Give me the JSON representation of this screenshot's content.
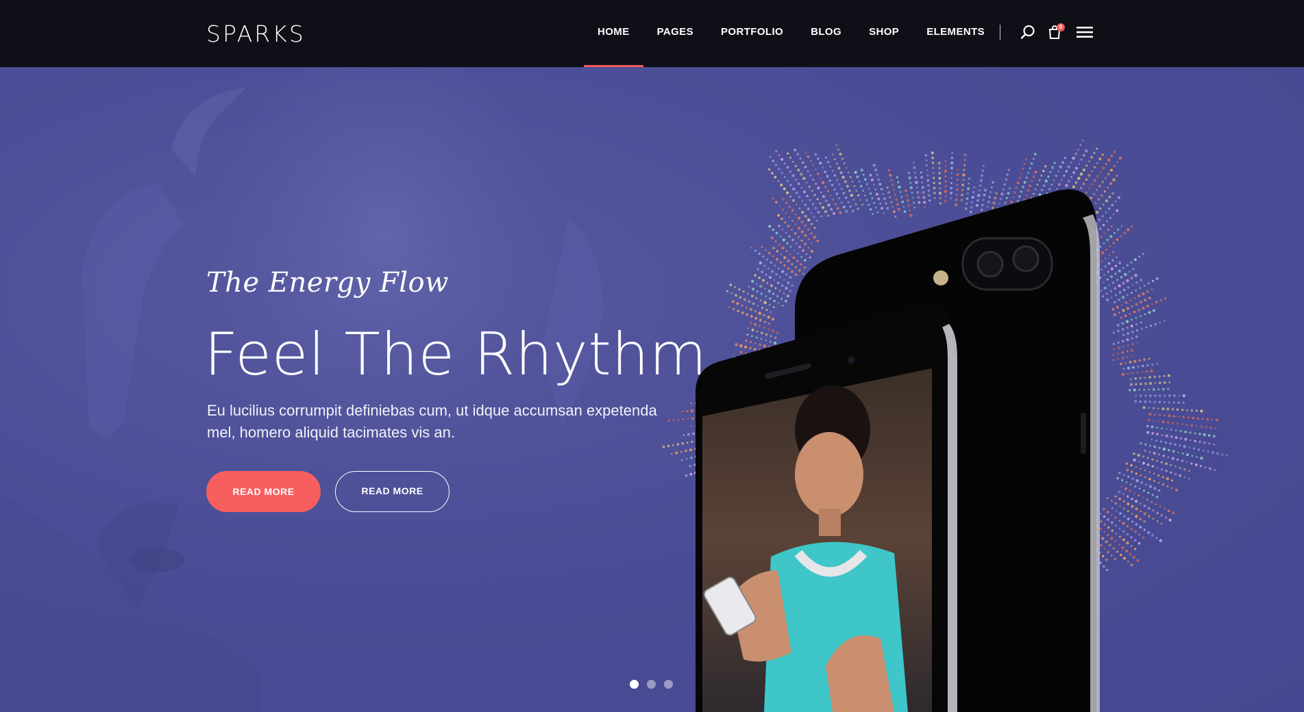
{
  "header": {
    "logo": "SPARKS",
    "nav": [
      {
        "label": "HOME",
        "active": true
      },
      {
        "label": "PAGES",
        "active": false
      },
      {
        "label": "PORTFOLIO",
        "active": false
      },
      {
        "label": "BLOG",
        "active": false
      },
      {
        "label": "SHOP",
        "active": false
      },
      {
        "label": "ELEMENTS",
        "active": false
      }
    ],
    "cart_count": "0",
    "icons": {
      "search": "search-icon",
      "cart": "shopping-bag-icon",
      "menu": "hamburger-menu-icon"
    }
  },
  "hero": {
    "tagline": "The Energy Flow",
    "headline": "Feel The Rhythm",
    "description": "Eu lucilius corrumpit definiebas cum, ut idque accumsan expetenda mel, homero aliquid tacimates vis an.",
    "primary_button": "READ MORE",
    "secondary_button": "READ MORE",
    "slider": {
      "count": 3,
      "active_index": 0
    }
  },
  "colors": {
    "header_bg": "#0f0f17",
    "hero_bg": "#4a4c96",
    "accent": "#f75f5f",
    "logo_accent": "#3fd2a4"
  }
}
